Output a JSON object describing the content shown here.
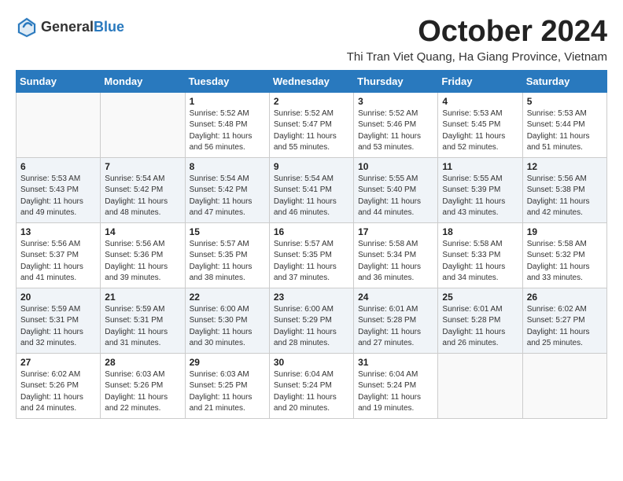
{
  "logo": {
    "general": "General",
    "blue": "Blue"
  },
  "header": {
    "month": "October 2024",
    "location": "Thi Tran Viet Quang, Ha Giang Province, Vietnam"
  },
  "days_of_week": [
    "Sunday",
    "Monday",
    "Tuesday",
    "Wednesday",
    "Thursday",
    "Friday",
    "Saturday"
  ],
  "weeks": [
    [
      {
        "day": "",
        "info": ""
      },
      {
        "day": "",
        "info": ""
      },
      {
        "day": "1",
        "info": "Sunrise: 5:52 AM\nSunset: 5:48 PM\nDaylight: 11 hours and 56 minutes."
      },
      {
        "day": "2",
        "info": "Sunrise: 5:52 AM\nSunset: 5:47 PM\nDaylight: 11 hours and 55 minutes."
      },
      {
        "day": "3",
        "info": "Sunrise: 5:52 AM\nSunset: 5:46 PM\nDaylight: 11 hours and 53 minutes."
      },
      {
        "day": "4",
        "info": "Sunrise: 5:53 AM\nSunset: 5:45 PM\nDaylight: 11 hours and 52 minutes."
      },
      {
        "day": "5",
        "info": "Sunrise: 5:53 AM\nSunset: 5:44 PM\nDaylight: 11 hours and 51 minutes."
      }
    ],
    [
      {
        "day": "6",
        "info": "Sunrise: 5:53 AM\nSunset: 5:43 PM\nDaylight: 11 hours and 49 minutes."
      },
      {
        "day": "7",
        "info": "Sunrise: 5:54 AM\nSunset: 5:42 PM\nDaylight: 11 hours and 48 minutes."
      },
      {
        "day": "8",
        "info": "Sunrise: 5:54 AM\nSunset: 5:42 PM\nDaylight: 11 hours and 47 minutes."
      },
      {
        "day": "9",
        "info": "Sunrise: 5:54 AM\nSunset: 5:41 PM\nDaylight: 11 hours and 46 minutes."
      },
      {
        "day": "10",
        "info": "Sunrise: 5:55 AM\nSunset: 5:40 PM\nDaylight: 11 hours and 44 minutes."
      },
      {
        "day": "11",
        "info": "Sunrise: 5:55 AM\nSunset: 5:39 PM\nDaylight: 11 hours and 43 minutes."
      },
      {
        "day": "12",
        "info": "Sunrise: 5:56 AM\nSunset: 5:38 PM\nDaylight: 11 hours and 42 minutes."
      }
    ],
    [
      {
        "day": "13",
        "info": "Sunrise: 5:56 AM\nSunset: 5:37 PM\nDaylight: 11 hours and 41 minutes."
      },
      {
        "day": "14",
        "info": "Sunrise: 5:56 AM\nSunset: 5:36 PM\nDaylight: 11 hours and 39 minutes."
      },
      {
        "day": "15",
        "info": "Sunrise: 5:57 AM\nSunset: 5:35 PM\nDaylight: 11 hours and 38 minutes."
      },
      {
        "day": "16",
        "info": "Sunrise: 5:57 AM\nSunset: 5:35 PM\nDaylight: 11 hours and 37 minutes."
      },
      {
        "day": "17",
        "info": "Sunrise: 5:58 AM\nSunset: 5:34 PM\nDaylight: 11 hours and 36 minutes."
      },
      {
        "day": "18",
        "info": "Sunrise: 5:58 AM\nSunset: 5:33 PM\nDaylight: 11 hours and 34 minutes."
      },
      {
        "day": "19",
        "info": "Sunrise: 5:58 AM\nSunset: 5:32 PM\nDaylight: 11 hours and 33 minutes."
      }
    ],
    [
      {
        "day": "20",
        "info": "Sunrise: 5:59 AM\nSunset: 5:31 PM\nDaylight: 11 hours and 32 minutes."
      },
      {
        "day": "21",
        "info": "Sunrise: 5:59 AM\nSunset: 5:31 PM\nDaylight: 11 hours and 31 minutes."
      },
      {
        "day": "22",
        "info": "Sunrise: 6:00 AM\nSunset: 5:30 PM\nDaylight: 11 hours and 30 minutes."
      },
      {
        "day": "23",
        "info": "Sunrise: 6:00 AM\nSunset: 5:29 PM\nDaylight: 11 hours and 28 minutes."
      },
      {
        "day": "24",
        "info": "Sunrise: 6:01 AM\nSunset: 5:28 PM\nDaylight: 11 hours and 27 minutes."
      },
      {
        "day": "25",
        "info": "Sunrise: 6:01 AM\nSunset: 5:28 PM\nDaylight: 11 hours and 26 minutes."
      },
      {
        "day": "26",
        "info": "Sunrise: 6:02 AM\nSunset: 5:27 PM\nDaylight: 11 hours and 25 minutes."
      }
    ],
    [
      {
        "day": "27",
        "info": "Sunrise: 6:02 AM\nSunset: 5:26 PM\nDaylight: 11 hours and 24 minutes."
      },
      {
        "day": "28",
        "info": "Sunrise: 6:03 AM\nSunset: 5:26 PM\nDaylight: 11 hours and 22 minutes."
      },
      {
        "day": "29",
        "info": "Sunrise: 6:03 AM\nSunset: 5:25 PM\nDaylight: 11 hours and 21 minutes."
      },
      {
        "day": "30",
        "info": "Sunrise: 6:04 AM\nSunset: 5:24 PM\nDaylight: 11 hours and 20 minutes."
      },
      {
        "day": "31",
        "info": "Sunrise: 6:04 AM\nSunset: 5:24 PM\nDaylight: 11 hours and 19 minutes."
      },
      {
        "day": "",
        "info": ""
      },
      {
        "day": "",
        "info": ""
      }
    ]
  ]
}
